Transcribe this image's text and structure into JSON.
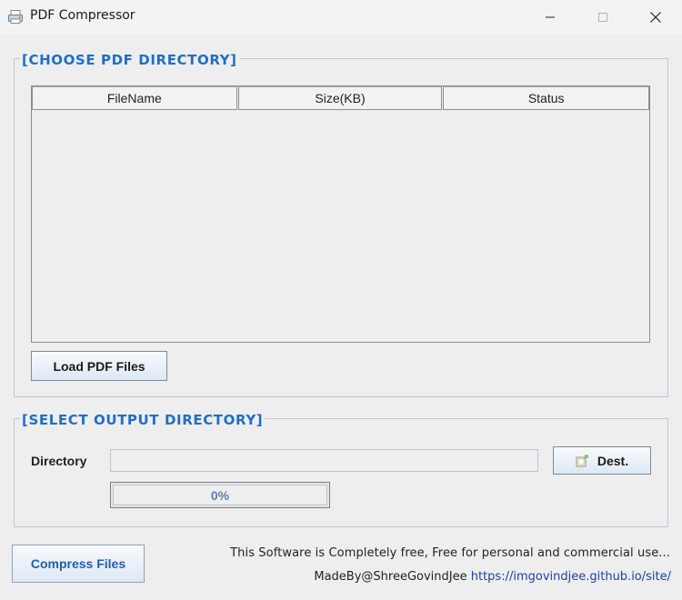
{
  "window": {
    "title": "PDF Compressor",
    "icon": "pdf-compressor-app-icon",
    "controls": [
      "minimize-icon",
      "maximize-icon",
      "close-icon"
    ]
  },
  "choose_section": {
    "title": "[CHOOSE PDF DIRECTORY]",
    "table": {
      "columns": [
        "FileName",
        "Size(KB)",
        "Status"
      ],
      "rows": []
    },
    "load_button_label": "Load PDF Files"
  },
  "output_section": {
    "title": "[SELECT OUTPUT DIRECTORY]",
    "directory_label": "Directory",
    "directory_value": "",
    "dest_button_label": "Dest.",
    "dest_button_icon": "folder-icon",
    "progress": {
      "text": "0%",
      "value": 0
    }
  },
  "compress_button_label": "Compress Files",
  "footer": {
    "note": "This Software is Completely free, Free for personal and commercial use...",
    "made_by": "MadeBy@ShreeGovindJee",
    "link_text": "https://imgovindjee.github.io/site/"
  },
  "colors": {
    "section_title": "#1e6fc8",
    "link": "#1f3fa8",
    "progress_text": "#5b7fae"
  }
}
